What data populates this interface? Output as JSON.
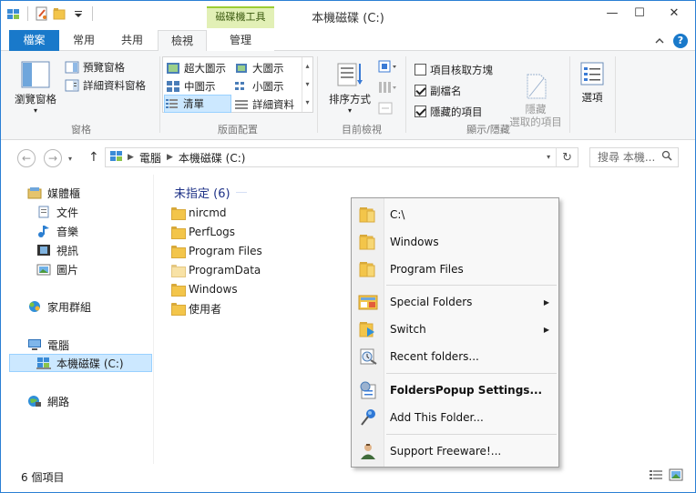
{
  "window": {
    "title": "本機磁碟 (C:)",
    "context_tab_header": "磁碟機工具",
    "controls": {
      "minimize": "—",
      "maximize": "☐",
      "close": "✕"
    }
  },
  "tabs": [
    {
      "label": "檔案"
    },
    {
      "label": "常用"
    },
    {
      "label": "共用"
    },
    {
      "label": "檢視"
    },
    {
      "label": "管理"
    }
  ],
  "ribbon": {
    "panes": {
      "navigation_pane": "瀏覽窗格",
      "preview_pane": "預覽窗格",
      "details_pane": "詳細資料窗格",
      "group_label": "窗格"
    },
    "layout": {
      "items": [
        "超大圖示",
        "大圖示",
        "中圖示",
        "小圖示",
        "清單",
        "詳細資料"
      ],
      "group_label": "版面配置"
    },
    "current_view": {
      "sort_by": "排序方式",
      "group_label": "目前檢視"
    },
    "show_hide": {
      "item_checkboxes": {
        "label": "項目核取方塊",
        "checked": false
      },
      "file_extensions": {
        "label": "副檔名",
        "checked": true
      },
      "hidden_items": {
        "label": "隱藏的項目",
        "checked": true
      },
      "hide_selected": "隱藏\n選取的項目",
      "group_label": "顯示/隱藏"
    },
    "options": "選項"
  },
  "address": {
    "segments": [
      "電腦",
      "本機磁碟 (C:)"
    ],
    "search_placeholder": "搜尋 本機..."
  },
  "nav": {
    "libraries": "媒體櫃",
    "documents": "文件",
    "music": "音樂",
    "videos": "視訊",
    "pictures": "圖片",
    "homegroup": "家用群組",
    "computer": "電腦",
    "local_disk": "本機磁碟 (C:)",
    "network": "網路"
  },
  "content": {
    "group_header": "未指定 (6)",
    "files": [
      {
        "name": "nircmd",
        "hidden": false
      },
      {
        "name": "PerfLogs",
        "hidden": false
      },
      {
        "name": "Program Files",
        "hidden": false
      },
      {
        "name": "ProgramData",
        "hidden": true
      },
      {
        "name": "Windows",
        "hidden": false
      },
      {
        "name": "使用者",
        "hidden": false
      }
    ]
  },
  "status": {
    "item_count": "6 個項目"
  },
  "popup": {
    "items": [
      {
        "label": "C:\\",
        "icon": "folder-icon"
      },
      {
        "label": "Windows",
        "icon": "folder-icon"
      },
      {
        "label": "Program Files",
        "icon": "folder-icon"
      },
      {
        "label": "Special Folders",
        "icon": "special-folders-icon",
        "submenu": true
      },
      {
        "label": "Switch",
        "icon": "switch-icon",
        "submenu": true
      },
      {
        "label": "Recent folders...",
        "icon": "recent-folders-icon"
      },
      {
        "label": "FoldersPopup Settings...",
        "icon": "settings-icon",
        "bold": true
      },
      {
        "label": "Add This Folder...",
        "icon": "pushpin-icon"
      },
      {
        "label": "Support Freeware!...",
        "icon": "support-icon"
      }
    ]
  },
  "colors": {
    "file_tab": "#1979ca",
    "context_tab": "#e2f0b6",
    "selection": "#cce8ff",
    "group_header": "#1e3287"
  }
}
